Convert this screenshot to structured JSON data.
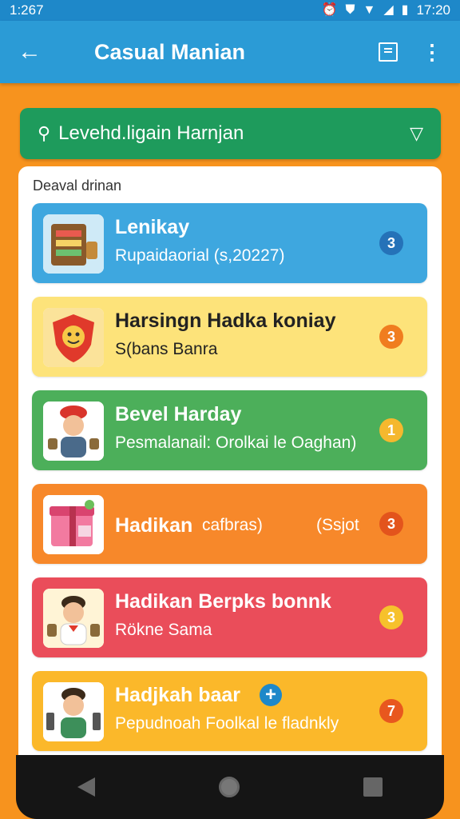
{
  "status_bar": {
    "time_left": "1:267",
    "time_right": "17:20"
  },
  "app_bar": {
    "title": "Casual Manian"
  },
  "filter": {
    "value": "Levehd.ligain Harnjan"
  },
  "card": {
    "heading": "Deaval drinan"
  },
  "items": [
    {
      "title": "Lenikay",
      "subtitle": "Rupaidaorial (s,20227)",
      "badge": "3",
      "bg": "#3ea7df",
      "text_color": "#ffffff",
      "badge_color": "#2572b8",
      "icon": "shop-icon"
    },
    {
      "title": "Harsingn Hadka koniay",
      "subtitle": "S(bans Banra",
      "badge": "3",
      "bg": "#fde37a",
      "text_color": "#222222",
      "badge_color": "#f07d1f",
      "icon": "shield-mascot-icon"
    },
    {
      "title": "Bevel Harday",
      "subtitle": "Pesmalanail: Orolkai le Oaghan)",
      "badge": "1",
      "bg": "#4caf5a",
      "text_color": "#ffffff",
      "badge_color": "#f5b82e",
      "icon": "person-red-hat-icon"
    },
    {
      "title": "Hadikan",
      "subtitle": "cafbras)",
      "note": "(Ssjot",
      "badge": "3",
      "bg": "#f7882a",
      "text_color": "#ffffff",
      "badge_color": "#e3541c",
      "icon": "gift-box-icon"
    },
    {
      "title": "Hadikan Berpks bonnk",
      "subtitle": "Rökne Sama",
      "badge": "3",
      "bg": "#ea4d5a",
      "text_color": "#ffffff",
      "badge_color": "#f6c12c",
      "icon": "person-boy-icon"
    },
    {
      "title": "Hadjkah baar",
      "subtitle": "Pepudnoah Foolkal le fladnkly",
      "badge": "7",
      "bg": "#fbb82a",
      "text_color": "#ffffff",
      "badge_color": "#e8571e",
      "icon": "person-tools-icon"
    }
  ]
}
